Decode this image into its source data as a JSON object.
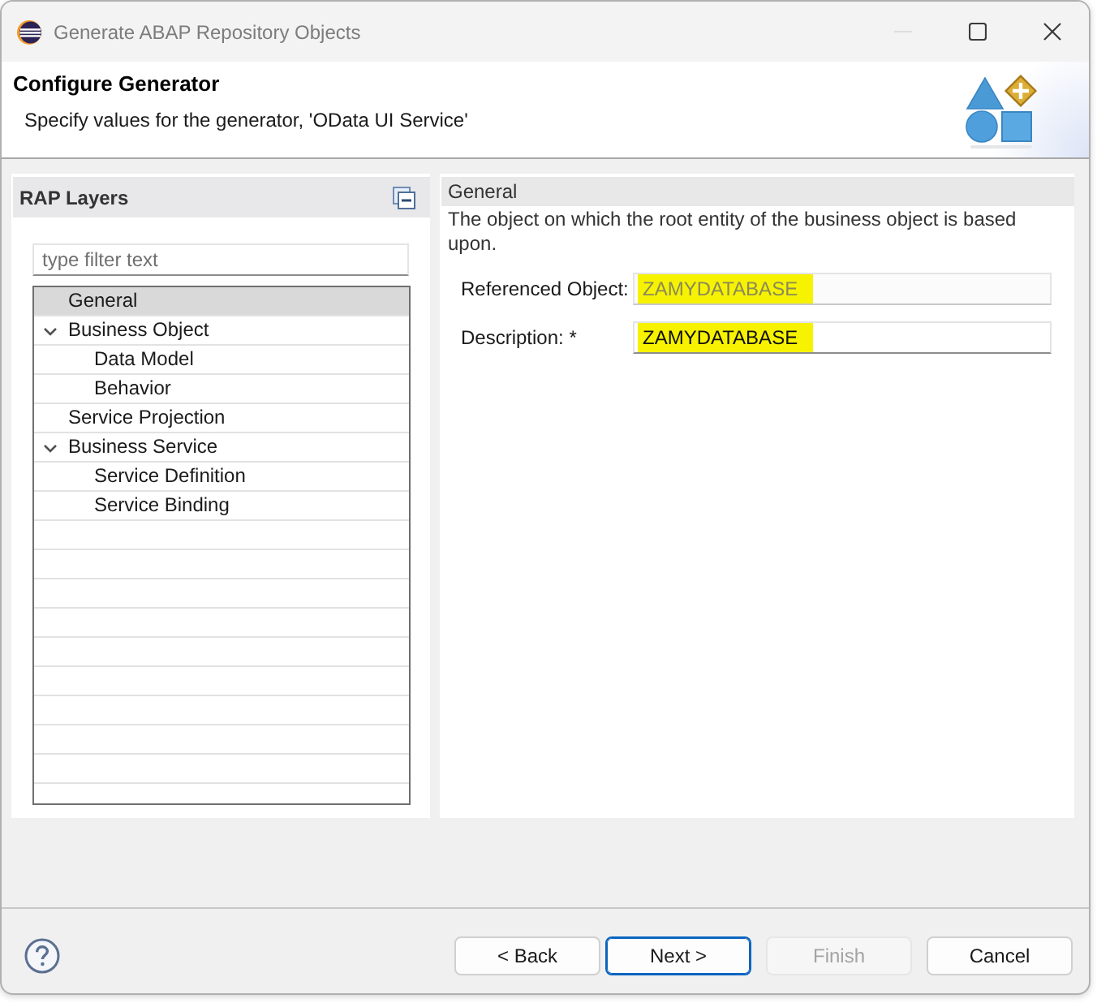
{
  "window": {
    "title": "Generate ABAP Repository Objects",
    "controls": [
      {
        "kind": "minimize",
        "disabled": true
      },
      {
        "kind": "maximize",
        "disabled": false
      },
      {
        "kind": "close",
        "disabled": false
      }
    ]
  },
  "header": {
    "title": "Configure Generator",
    "subtitle": "Specify values for the generator, 'OData UI Service'"
  },
  "layers_panel": {
    "title": "RAP Layers",
    "filter": {
      "placeholder": "type filter text"
    },
    "tree": [
      {
        "label": "General",
        "selected": true
      },
      {
        "label": "Business Object",
        "selected": false,
        "expanded": true,
        "children": [
          {
            "label": "Data Model",
            "selected": false
          },
          {
            "label": "Behavior",
            "selected": false
          }
        ]
      },
      {
        "label": "Service Projection",
        "selected": false
      },
      {
        "label": "Business Service",
        "selected": false,
        "expanded": true,
        "children": [
          {
            "label": "Service Definition",
            "selected": false
          },
          {
            "label": "Service Binding",
            "selected": false
          }
        ]
      }
    ]
  },
  "details_panel": {
    "title": "General",
    "description": "The object on which the root entity of the business object is based upon.",
    "fields": [
      {
        "label": "Referenced Object:",
        "value": "ZAMYDATABASE",
        "disabled": true,
        "highlighted": true
      },
      {
        "label": "Description: *",
        "value": "ZAMYDATABASE",
        "disabled": false,
        "highlighted": true
      }
    ]
  },
  "buttons": [
    {
      "label": "< Back",
      "disabled": false,
      "default": false
    },
    {
      "label": "Next >",
      "disabled": false,
      "default": true
    },
    {
      "label": "Finish",
      "disabled": true,
      "default": false
    },
    {
      "label": "Cancel",
      "disabled": false,
      "default": false
    }
  ]
}
